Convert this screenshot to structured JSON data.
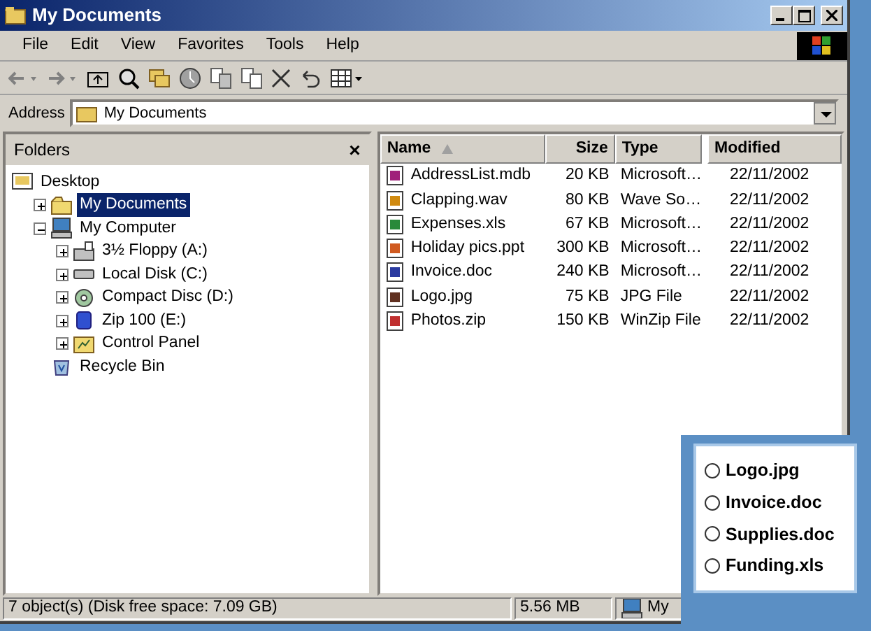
{
  "window": {
    "title": "My Documents"
  },
  "menu": [
    {
      "label": "File"
    },
    {
      "label": "Edit"
    },
    {
      "label": "View"
    },
    {
      "label": "Favorites"
    },
    {
      "label": "Tools"
    },
    {
      "label": "Help"
    }
  ],
  "address": {
    "label": "Address",
    "value": "My Documents"
  },
  "folders": {
    "title": "Folders",
    "close": "×",
    "tree": [
      {
        "label": "Desktop",
        "kind": "desktop",
        "selected": false,
        "children": [
          {
            "label": "My Documents",
            "kind": "folder",
            "selected": true,
            "expanded": false
          },
          {
            "label": "My Computer",
            "kind": "computer",
            "selected": false,
            "expanded": true,
            "children": [
              {
                "label": "3½ Floppy (A:)",
                "kind": "floppy",
                "selected": false,
                "expanded": false
              },
              {
                "label": "Local Disk (C:)",
                "kind": "disk",
                "selected": false,
                "expanded": false
              },
              {
                "label": "Compact Disc (D:)",
                "kind": "cd",
                "selected": false,
                "expanded": false
              },
              {
                "label": "Zip 100  (E:)",
                "kind": "zip",
                "selected": false,
                "expanded": false
              },
              {
                "label": "Control Panel",
                "kind": "panel",
                "selected": false,
                "expanded": false
              }
            ]
          },
          {
            "label": "Recycle Bin",
            "kind": "bin",
            "selected": false
          }
        ]
      }
    ]
  },
  "files": {
    "columns": [
      {
        "label": "Name",
        "sorted": true
      },
      {
        "label": "Size",
        "sorted": false
      },
      {
        "label": "Type",
        "sorted": false
      },
      {
        "label": "Modified",
        "sorted": false
      }
    ],
    "rows": [
      {
        "name": "AddressList.mdb",
        "size": "20 KB",
        "type": "Microsoft…",
        "modified": "22/11/2002",
        "color": "#a0207a"
      },
      {
        "name": "Clapping.wav",
        "size": "80 KB",
        "type": "Wave So…",
        "modified": "22/11/2002",
        "color": "#d08a10"
      },
      {
        "name": "Expenses.xls",
        "size": "67 KB",
        "type": "Microsoft…",
        "modified": "22/11/2002",
        "color": "#2a8a3a"
      },
      {
        "name": "Holiday pics.ppt",
        "size": "300 KB",
        "type": "Microsoft…",
        "modified": "22/11/2002",
        "color": "#d05a20"
      },
      {
        "name": "Invoice.doc",
        "size": "240 KB",
        "type": "Microsoft…",
        "modified": "22/11/2002",
        "color": "#2a3aa0"
      },
      {
        "name": "Logo.jpg",
        "size": "75 KB",
        "type": "JPG File",
        "modified": "22/11/2002",
        "color": "#603020"
      },
      {
        "name": "Photos.zip",
        "size": "150 KB",
        "type": "WinZip File",
        "modified": "22/11/2002",
        "color": "#c03030"
      }
    ]
  },
  "status_bar": [
    {
      "text": "7 object(s) (Disk free space: 7.09 GB)"
    },
    {
      "text": "5.56 MB"
    },
    {
      "text": "My"
    }
  ],
  "quiz": {
    "options": [
      {
        "label": "Logo.jpg",
        "selected": false
      },
      {
        "label": "Invoice.doc",
        "selected": false
      },
      {
        "label": "Supplies.doc",
        "selected": false
      },
      {
        "label": "Funding.xls",
        "selected": false
      }
    ]
  }
}
